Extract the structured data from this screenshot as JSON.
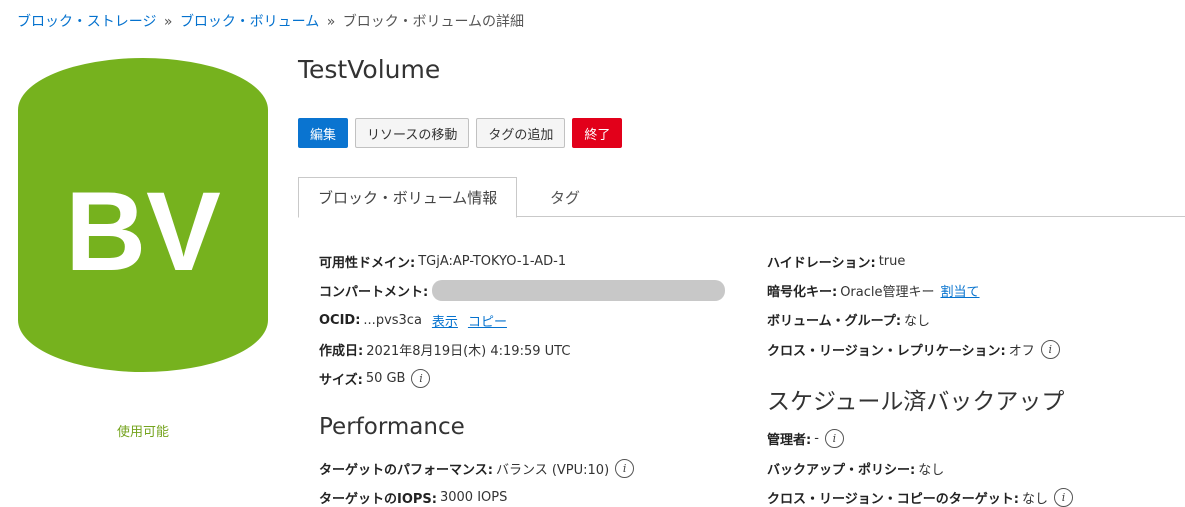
{
  "breadcrumb": {
    "item1": "ブロック・ストレージ",
    "item2": "ブロック・ボリューム",
    "current": "ブロック・ボリュームの詳細",
    "separator": "»"
  },
  "badge": {
    "text": "BV",
    "color": "#76b21e",
    "status": "使用可能"
  },
  "title": "TestVolume",
  "actions": {
    "edit": "編集",
    "move": "リソースの移動",
    "add_tags": "タグの追加",
    "terminate": "終了"
  },
  "tabs": {
    "info": "ブロック・ボリューム情報",
    "tags": "タグ"
  },
  "left": {
    "availability_domain": {
      "label": "可用性ドメイン:",
      "value": "TGjA:AP-TOKYO-1-AD-1"
    },
    "compartment": {
      "label": "コンパートメント:"
    },
    "ocid": {
      "label": "OCID:",
      "value": "...pvs3ca",
      "show": "表示",
      "copy": "コピー"
    },
    "created": {
      "label": "作成日:",
      "value": "2021年8月19日(木) 4:19:59 UTC"
    },
    "size": {
      "label": "サイズ:",
      "value": "50 GB"
    },
    "performance_heading": "Performance",
    "target_performance": {
      "label": "ターゲットのパフォーマンス:",
      "value": "バランス (VPU:10)"
    },
    "target_iops": {
      "label": "ターゲットのIOPS:",
      "value": "3000 IOPS"
    }
  },
  "right": {
    "hydration": {
      "label": "ハイドレーション:",
      "value": "true"
    },
    "encryption": {
      "label": "暗号化キー:",
      "value": "Oracle管理キー",
      "assign": "割当て"
    },
    "volume_group": {
      "label": "ボリューム・グループ:",
      "value": "なし"
    },
    "cross_region_replication": {
      "label": "クロス・リージョン・レプリケーション:",
      "value": "オフ"
    },
    "schedule_heading": "スケジュール済バックアップ",
    "manager": {
      "label": "管理者:",
      "value": "-"
    },
    "backup_policy": {
      "label": "バックアップ・ポリシー:",
      "value": "なし"
    },
    "cross_region_copy": {
      "label": "クロス・リージョン・コピーのターゲット:",
      "value": "なし"
    }
  },
  "info_icon_glyph": "i"
}
